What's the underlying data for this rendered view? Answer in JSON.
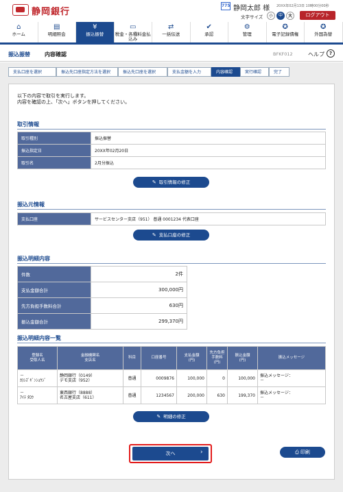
{
  "header": {
    "bank_name": "静岡銀行",
    "user_tag": "775",
    "user_name": "静岡太郎 様",
    "last_login": "20XX年02月13日 10時00分00秒",
    "font_size_label": "文字サイズ",
    "font_small": "小",
    "font_mid": "中",
    "font_large": "大",
    "logout": "ログアウト"
  },
  "nav": [
    {
      "label": "ホーム",
      "icon": "home-icon"
    },
    {
      "label": "明細照会",
      "icon": "document-icon"
    },
    {
      "label": "振込振替",
      "icon": "yen-icon"
    },
    {
      "label": "税金・各種料金払込み",
      "icon": "card-icon"
    },
    {
      "label": "一括伝送",
      "icon": "transfer-icon"
    },
    {
      "label": "承認",
      "icon": "approve-icon"
    },
    {
      "label": "管理",
      "icon": "manage-icon"
    },
    {
      "label": "電子記録債権",
      "icon": "ecr-icon"
    },
    {
      "label": "外国為替",
      "icon": "forex-icon"
    }
  ],
  "page": {
    "title_a": "振込振替",
    "title_b": "内容確認",
    "screen_id": "BFKF012",
    "help": "ヘルプ"
  },
  "steps": [
    "支払口座を選択",
    "振込先口座指定方法を選択",
    "振込先口座を選択",
    "支払金額を入力",
    "内容確認",
    "実行確認",
    "完了"
  ],
  "intro": {
    "line1": "以下の内容で取引を実行します。",
    "line2": "内容を確認の上、「次へ」ボタンを押してください。"
  },
  "trade_info": {
    "title": "取引情報",
    "rows": [
      {
        "label": "取引種別",
        "value": "振込振替"
      },
      {
        "label": "振込指定日",
        "value": "20XX年02月20日"
      },
      {
        "label": "取引名",
        "value": "2月分振込"
      }
    ],
    "edit_button": "取引情報の修正"
  },
  "source_info": {
    "title": "振込元情報",
    "rows": [
      {
        "label": "支払口座",
        "value": "サービスセンター支店（951） 普通 0001234 代表口座"
      }
    ],
    "edit_button": "支払口座の修正"
  },
  "detail_summary": {
    "title": "振込明細内容",
    "rows": [
      {
        "label": "件数",
        "value": "2件"
      },
      {
        "label": "支払金額合計",
        "value": "300,000円"
      },
      {
        "label": "先方負担手数料合計",
        "value": "630円"
      },
      {
        "label": "振込金額合計",
        "value": "299,370円"
      }
    ]
  },
  "detail_list": {
    "title": "振込明細内容一覧",
    "headers": [
      "登録名\n受取人名",
      "金融機関名\n支店名",
      "科目",
      "口座番号",
      "支払金額\n(円)",
      "先方負担\n手数料\n(円)",
      "振込金額\n(円)",
      "振込メッセージ"
    ],
    "rows": [
      {
        "name": "－",
        "payee": "ｶ)ｼｽﾞｷﾞﾝｼｮｳｼﾞ",
        "bank": "静岡銀行（0149）",
        "branch": "デモ支店（952）",
        "type": "普通",
        "account": "0009876",
        "amount": "100,000",
        "fee": "0",
        "transfer": "100,000",
        "msg1": "振込メッセージ：",
        "msg2": "－"
      },
      {
        "name": "－",
        "payee": "ｱｲﾃ ﾀﾛｳ",
        "bank": "東西銀行（8888）",
        "branch": "名古屋支店（611）",
        "type": "普通",
        "account": "1234567",
        "amount": "200,000",
        "fee": "630",
        "transfer": "199,370",
        "msg1": "振込メッセージ：",
        "msg2": "－"
      }
    ],
    "edit_button": "明細の修正"
  },
  "actions": {
    "next": "次へ",
    "print": "印刷"
  },
  "colors": {
    "brand_red": "#c0282d",
    "nav_blue": "#1c4a8f",
    "table_header": "#51699b"
  }
}
